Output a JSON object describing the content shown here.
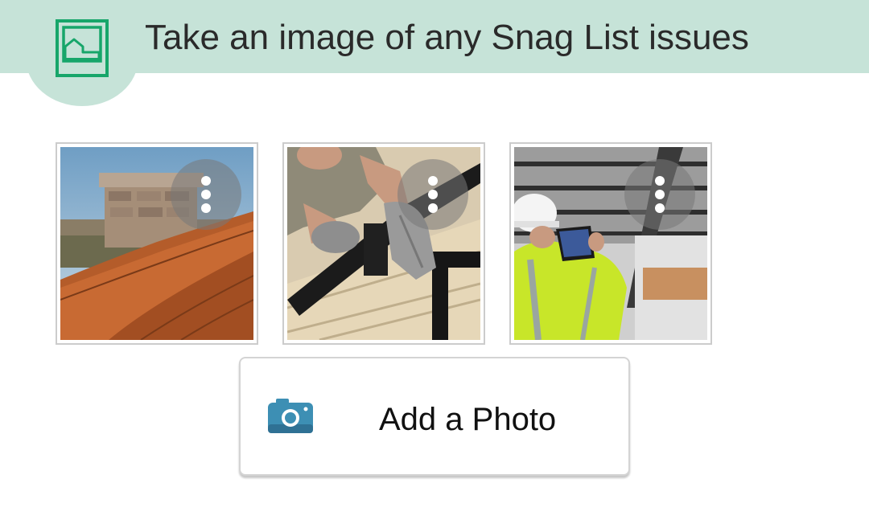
{
  "header": {
    "title": "Take an image of any Snag List issues",
    "icon": "house-picture-icon",
    "background_color": "#c6e3d8",
    "icon_color": "#17a66a"
  },
  "photos": [
    {
      "subject": "chimney-and-roof-ridge-tiles",
      "menu_icon": "more-vertical-icon"
    },
    {
      "subject": "worker-fitting-gutter-downpipe",
      "menu_icon": "more-vertical-icon"
    },
    {
      "subject": "engineer-in-hi-vis-with-tablet",
      "menu_icon": "more-vertical-icon"
    }
  ],
  "add_photo": {
    "label": "Add a Photo",
    "icon": "camera-icon",
    "icon_color": "#3d8fb4"
  }
}
